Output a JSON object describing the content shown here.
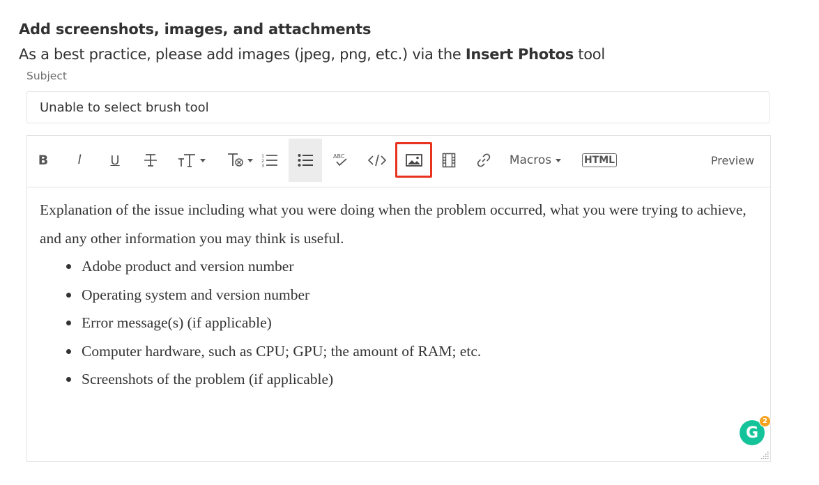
{
  "heading": "Add screenshots, images, and attachments",
  "description": {
    "prefix": "As a best practice, please add images (jpeg, png, etc.) via the ",
    "bold": "Insert Photos",
    "suffix": " tool"
  },
  "subject": {
    "label": "Subject",
    "value": "Unable to select brush tool"
  },
  "toolbar": {
    "bold_label": "B",
    "italic_label": "I",
    "underline_label": "U",
    "macros_label": "Macros",
    "html_label": "HTML",
    "preview_label": "Preview",
    "active_tool": "bullet-list",
    "highlighted_tool": "insert-photos",
    "highlight_color": "#e8331f"
  },
  "body": {
    "intro": "Explanation of the issue including what you were doing when the problem occurred, what you were trying to achieve, and any other information you may think is useful.",
    "items": [
      "Adobe product and version number",
      "Operating system and version number",
      "Error message(s) (if applicable)",
      "Computer hardware, such as CPU; GPU; the amount of RAM; etc.",
      "Screenshots of the problem (if applicable)"
    ]
  },
  "grammarly": {
    "letter": "G",
    "badge_count": "2",
    "color": "#15c39a",
    "badge_color": "#f7a21c"
  }
}
